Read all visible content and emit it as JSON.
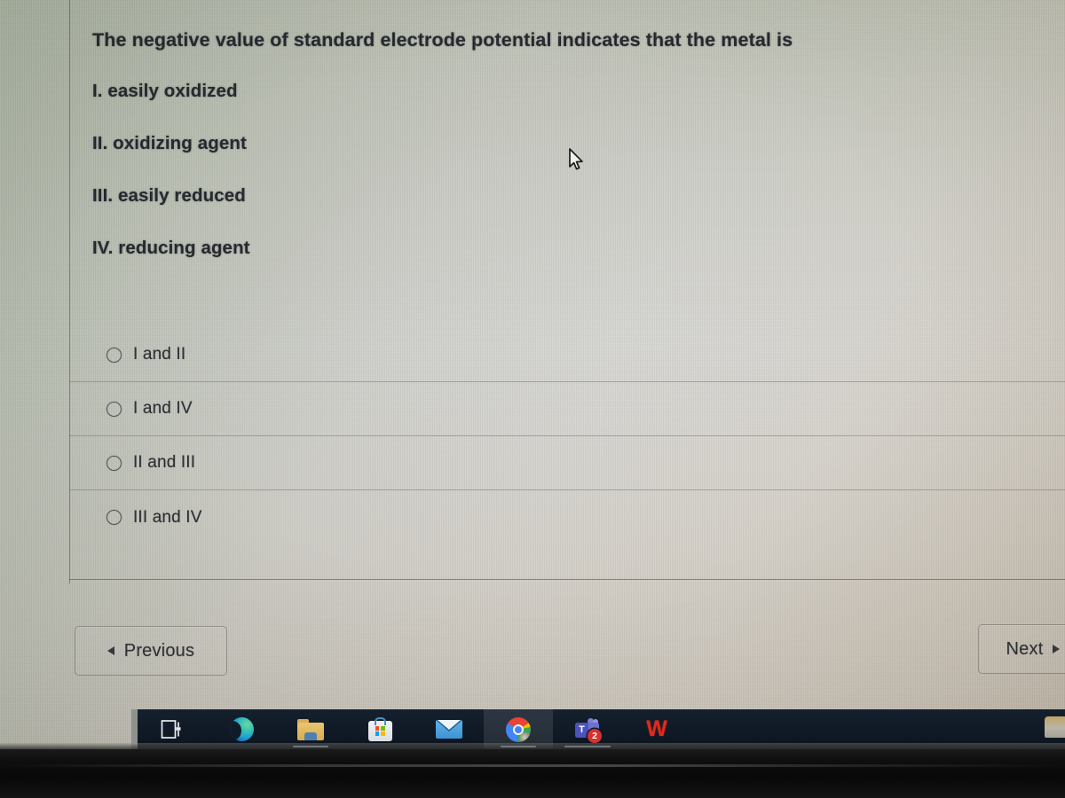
{
  "quiz": {
    "question_stem": "The negative value of standard electrode potential indicates that the metal is",
    "statements": [
      "I. easily oxidized",
      "II. oxidizing agent",
      "III. easily reduced",
      "IV. reducing agent"
    ],
    "options": [
      {
        "label": "I and II",
        "selected": false
      },
      {
        "label": "I and IV",
        "selected": false
      },
      {
        "label": "II and III",
        "selected": false
      },
      {
        "label": "III and IV",
        "selected": false
      }
    ],
    "nav": {
      "previous_label": "Previous",
      "next_label": "Next"
    }
  },
  "taskbar": {
    "items": [
      {
        "name": "task-view",
        "label": "Task View",
        "active": false,
        "running": false
      },
      {
        "name": "microsoft-edge",
        "label": "Microsoft Edge",
        "active": false,
        "running": false
      },
      {
        "name": "file-explorer",
        "label": "File Explorer",
        "active": false,
        "running": true
      },
      {
        "name": "microsoft-store",
        "label": "Microsoft Store",
        "active": false,
        "running": false
      },
      {
        "name": "mail",
        "label": "Mail",
        "active": false,
        "running": false
      },
      {
        "name": "google-chrome",
        "label": "Google Chrome",
        "active": true,
        "running": true
      },
      {
        "name": "microsoft-teams",
        "label": "Microsoft Teams",
        "active": false,
        "running": true,
        "badge": "2"
      },
      {
        "name": "wps-office",
        "label": "WPS Office",
        "active": false,
        "running": false
      }
    ],
    "teams_letter": "T",
    "wps_letter": "W"
  },
  "colors": {
    "screen_tint_green": "#b9bfb0",
    "screen_tint_warm": "#cdc6bb",
    "text": "#20242a",
    "rule": "#5f625c",
    "taskbar_bg": "#101a26",
    "teams_badge": "#d6322c",
    "bezel": "#0d0d0d"
  }
}
